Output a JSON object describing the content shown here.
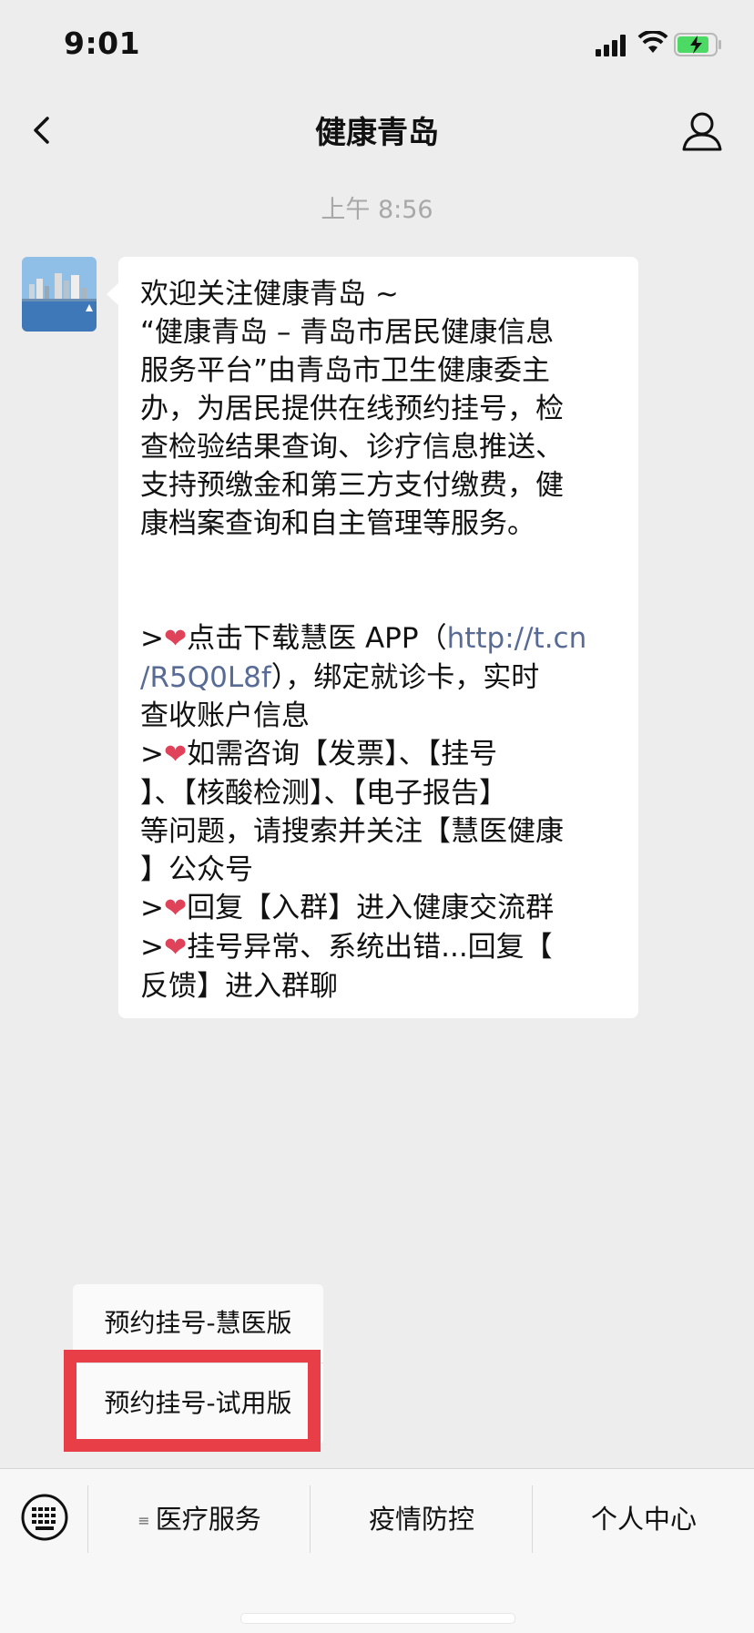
{
  "status_bar": {
    "time": "9:01"
  },
  "nav": {
    "title": "健康青岛"
  },
  "chat": {
    "timestamp": "上午 8:56",
    "message_lines": [
      "欢迎关注健康青岛 ~",
      "“健康青岛 – 青岛市居民健康信息",
      "服务平台”由青岛市卫生健康委主",
      "办，为居民提供在线预约挂号，检",
      "查检验结果查询、诊疗信息推送、",
      "支持预缴金和第三方支付缴费，健",
      "康档案查询和自主管理等服务。"
    ],
    "items": [
      {
        "prefix": ">",
        "lines": [
          "点击下载慧医 APP（",
          "http://t.cn",
          "/R5Q0L8f",
          "），绑定就诊卡，实时",
          "查收账户信息"
        ]
      },
      {
        "prefix": ">",
        "lines": [
          "如需咨询【发票】、【挂号",
          "】、【核酸检测】、【电子报告】",
          "等问题，请搜索并关注【慧医健康",
          "】公众号"
        ]
      },
      {
        "prefix": ">",
        "lines": [
          "回复【入群】进入健康交流群"
        ]
      },
      {
        "prefix": ">",
        "lines": [
          "挂号异常、系统出错...回复【",
          "反馈】进入群聊"
        ]
      }
    ]
  },
  "popup_menu": {
    "items": [
      "预约挂号-慧医版",
      "预约挂号-试用版"
    ]
  },
  "bottom_menu": {
    "tabs": [
      "医疗服务",
      "疫情防控",
      "个人中心"
    ]
  },
  "colors": {
    "link": "#576b95",
    "highlight": "#e83e47",
    "heart": "#e0425a",
    "battery": "#4cd964"
  },
  "icons": {
    "back": "chevron-left-icon",
    "profile": "person-icon",
    "keyboard": "keyboard-icon",
    "heart": "heart-icon"
  }
}
